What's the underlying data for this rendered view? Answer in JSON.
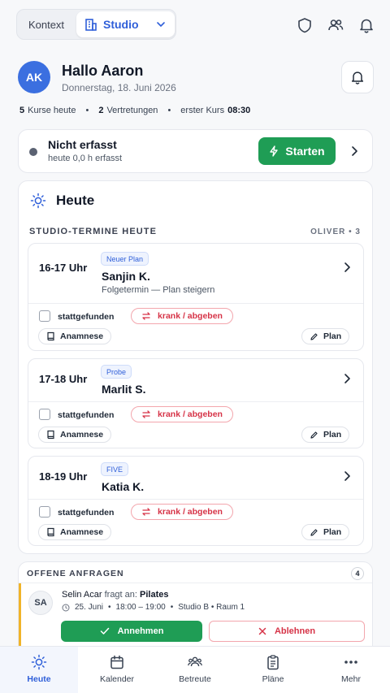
{
  "topbar": {
    "context_label": "Kontext",
    "studio_label": "Studio"
  },
  "hero": {
    "avatar_initials": "AK",
    "greeting": "Hallo Aaron",
    "date": "Donnerstag, 18. Juni 2026",
    "stats": {
      "courses_count": "5",
      "courses_label": "Kurse heute",
      "subs_count": "2",
      "subs_label": "Vertretungen",
      "first_label": "erster Kurs",
      "first_time": "08:30"
    }
  },
  "time_tracking": {
    "title": "Nicht erfasst",
    "subtitle": "heute 0,0 h erfasst",
    "start_label": "Starten"
  },
  "today": {
    "title": "Heute",
    "section_label": "STUDIO-TERMINE HEUTE",
    "section_meta": "OLIVER • 3",
    "appointments": [
      {
        "slot": "16-17 Uhr",
        "tag": "Neuer Plan",
        "name": "Sanjin K.",
        "note": "Folgetermin — Plan steigern",
        "checkbox_label": "stattgefunden",
        "sick_label": "krank / abgeben",
        "anamnese_label": "Anamnese",
        "plan_label": "Plan"
      },
      {
        "slot": "17-18 Uhr",
        "tag": "Probe",
        "name": "Marlit S.",
        "note": "",
        "checkbox_label": "stattgefunden",
        "sick_label": "krank / abgeben",
        "anamnese_label": "Anamnese",
        "plan_label": "Plan"
      },
      {
        "slot": "18-19 Uhr",
        "tag": "FIVE",
        "name": "Katia K.",
        "note": "",
        "checkbox_label": "stattgefunden",
        "sick_label": "krank / abgeben",
        "anamnese_label": "Anamnese",
        "plan_label": "Plan"
      }
    ]
  },
  "requests": {
    "label": "OFFENE ANFRAGEN",
    "count": "4",
    "items": [
      {
        "initials": "SA",
        "person": "Selin Acar",
        "asks": "fragt an:",
        "course": "Pilates",
        "date": "25. Juni",
        "time": "18:00 – 19:00",
        "room": "Studio B • Raum 1",
        "accept_label": "Annehmen",
        "decline_label": "Ablehnen"
      }
    ]
  },
  "nav": {
    "items": [
      {
        "label": "Heute"
      },
      {
        "label": "Kalender"
      },
      {
        "label": "Betreute"
      },
      {
        "label": "Pläne"
      },
      {
        "label": "Mehr"
      }
    ]
  },
  "colors": {
    "accent": "#2f5fd9",
    "success": "#1f9d55",
    "danger": "#d63347",
    "warning": "#f0b429"
  }
}
